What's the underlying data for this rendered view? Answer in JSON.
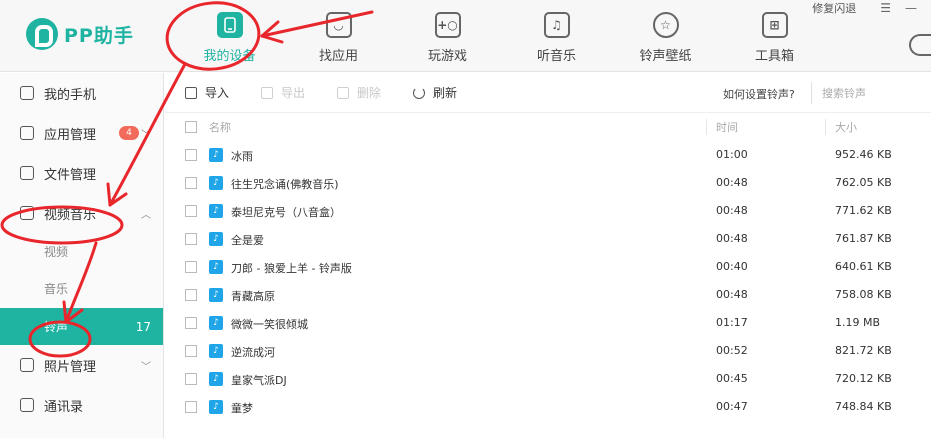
{
  "app": {
    "logo_text": "PP助手"
  },
  "titlebar": {
    "restore_label": "修复闪退",
    "menu_glyph": "☰",
    "minimize_glyph": "—"
  },
  "nav": {
    "items": [
      {
        "label": "我的设备",
        "icon": "device-icon",
        "glyph": "",
        "active": true
      },
      {
        "label": "找应用",
        "icon": "app-store-icon",
        "glyph": "◡"
      },
      {
        "label": "玩游戏",
        "icon": "gamepad-icon",
        "glyph": "+○"
      },
      {
        "label": "听音乐",
        "icon": "music-icon",
        "glyph": "♫"
      },
      {
        "label": "铃声壁纸",
        "icon": "star-icon",
        "glyph": "☆"
      },
      {
        "label": "工具箱",
        "icon": "toolbox-icon",
        "glyph": "⊞"
      }
    ]
  },
  "sidebar": {
    "items": [
      {
        "label": "我的手机",
        "icon": "phone-icon"
      },
      {
        "label": "应用管理",
        "icon": "app-manage-icon",
        "badge": "4"
      },
      {
        "label": "文件管理",
        "icon": "folder-icon"
      },
      {
        "label": "视频音乐",
        "icon": "video-icon",
        "expanded": true
      },
      {
        "label": "照片管理",
        "icon": "photo-icon"
      },
      {
        "label": "通讯录",
        "icon": "contacts-icon"
      }
    ],
    "sub_items": [
      {
        "label": "视频"
      },
      {
        "label": "音乐"
      },
      {
        "label": "铃声",
        "count": "17",
        "active": true
      }
    ]
  },
  "toolbar": {
    "import_label": "导入",
    "export_label": "导出",
    "delete_label": "删除",
    "refresh_label": "刷新",
    "help_link": "如何设置铃声?",
    "search_placeholder": "搜索铃声"
  },
  "table": {
    "columns": {
      "name": "名称",
      "time": "时间",
      "size": "大小"
    },
    "rows": [
      {
        "name": "冰雨",
        "time": "01:00",
        "size": "952.46 KB"
      },
      {
        "name": "往生咒念诵(佛教音乐)",
        "time": "00:48",
        "size": "762.05 KB"
      },
      {
        "name": "泰坦尼克号（八音盒）",
        "time": "00:48",
        "size": "771.62 KB"
      },
      {
        "name": "全是爱",
        "time": "00:48",
        "size": "761.87 KB"
      },
      {
        "name": "刀郎 - 狼爱上羊 - 铃声版",
        "time": "00:40",
        "size": "640.61 KB"
      },
      {
        "name": "青藏高原",
        "time": "00:48",
        "size": "758.08 KB"
      },
      {
        "name": "微微一笑很倾城",
        "time": "01:17",
        "size": "1.19 MB"
      },
      {
        "name": "逆流成河",
        "time": "00:52",
        "size": "821.72 KB"
      },
      {
        "name": "皇家气派DJ",
        "time": "00:45",
        "size": "720.12 KB"
      },
      {
        "name": "童梦",
        "time": "00:47",
        "size": "748.84 KB"
      }
    ]
  },
  "colors": {
    "accent": "#1fb3a2",
    "annotation": "#e8262b",
    "ringtone_icon": "#20a6e8",
    "badge": "#f26a5a"
  }
}
